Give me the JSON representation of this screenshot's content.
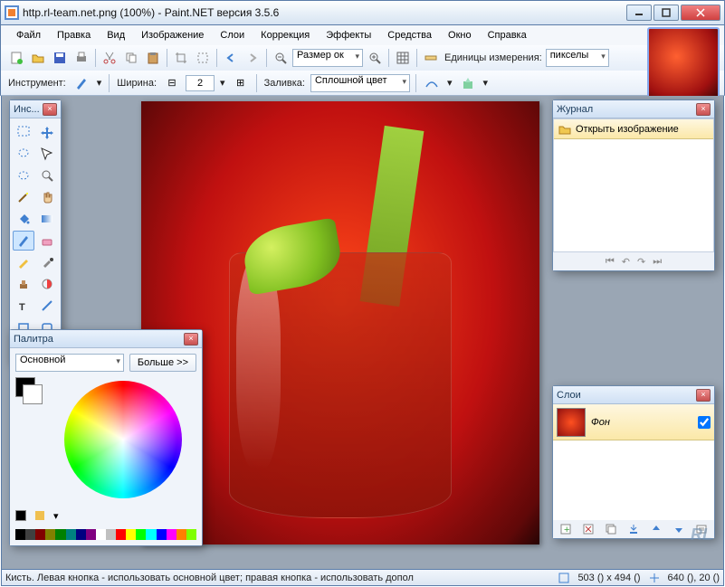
{
  "title": "http.rl-team.net.png (100%) - Paint.NET версия 3.5.6",
  "menu": [
    "Файл",
    "Правка",
    "Вид",
    "Изображение",
    "Слои",
    "Коррекция",
    "Эффекты",
    "Средства",
    "Окно",
    "Справка"
  ],
  "toolbar1": {
    "zoom_label": "Размер ок",
    "units_label": "Единицы измерения:",
    "units_value": "пикселы"
  },
  "toolbar2": {
    "tool_label": "Инструмент:",
    "width_label": "Ширина:",
    "width_value": "2",
    "fill_label": "Заливка:",
    "fill_value": "Сплошной цвет"
  },
  "panels": {
    "tools_title": "Инс...",
    "palette_title": "Палитра",
    "palette_mode": "Основной",
    "palette_more": "Больше >>",
    "history_title": "Журнал",
    "history_item": "Открыть изображение",
    "layers_title": "Слои",
    "layer_name": "Фон"
  },
  "palette_colors": [
    "#000",
    "#404040",
    "#800000",
    "#808000",
    "#008000",
    "#008080",
    "#000080",
    "#800080",
    "#fff",
    "#c0c0c0",
    "#f00",
    "#ff0",
    "#0f0",
    "#0ff",
    "#00f",
    "#f0f",
    "#ff8000",
    "#80ff00"
  ],
  "status": {
    "hint": "Кисть. Левая кнопка - использовать основной цвет; правая кнопка - использовать допол",
    "size": "503 () x 494 ()",
    "pos": "640 (), 20 ()"
  },
  "rl": "RL"
}
